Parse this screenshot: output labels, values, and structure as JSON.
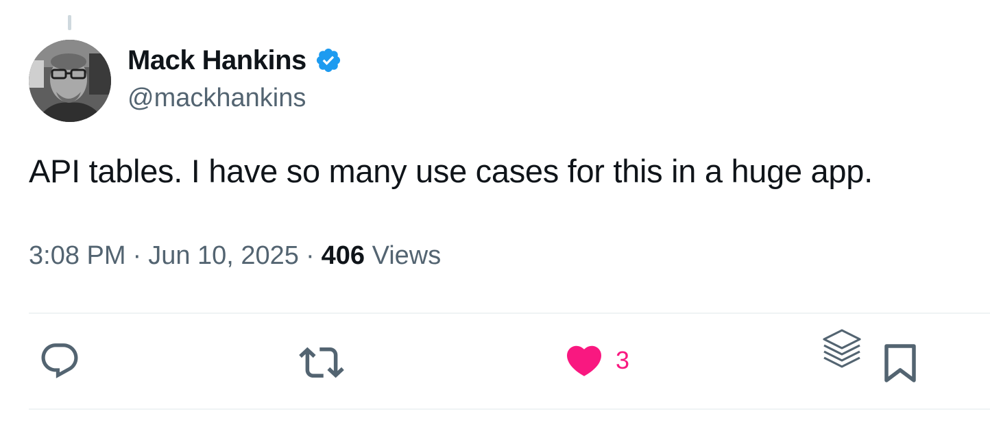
{
  "author": {
    "display_name": "Mack Hankins",
    "handle": "@mackhankins",
    "verified": true,
    "avatar_icon": "profile-photo",
    "verified_color": "#1d9bf0"
  },
  "tweet": {
    "text": "API tables. I have so many use cases for this in a huge app."
  },
  "meta": {
    "time": "3:08 PM",
    "separator": "·",
    "date": "Jun 10, 2025",
    "views_count": "406",
    "views_label": "Views"
  },
  "actions": {
    "reply_icon": "reply-icon",
    "retweet_icon": "retweet-icon",
    "like_icon": "heart-icon",
    "like_count": "3",
    "like_color": "#f91880",
    "grok_icon": "layers-icon",
    "bookmark_icon": "bookmark-icon"
  },
  "colors": {
    "text_primary": "#0f1419",
    "text_secondary": "#536471",
    "divider": "#eff3f4"
  }
}
